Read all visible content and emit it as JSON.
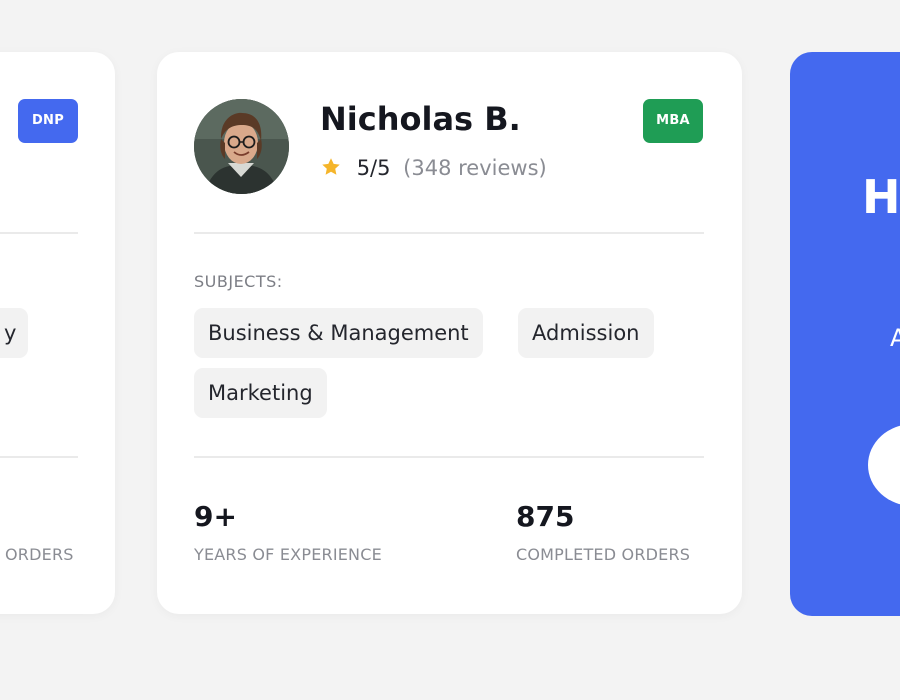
{
  "left_card": {
    "badge": "DNP",
    "tag_fragment": "y",
    "stat_label_fragment": "ORDERS",
    "badge_color": "#4469ef"
  },
  "main_card": {
    "name": "Nicholas B.",
    "rating": "5/5",
    "reviews": "(348 reviews)",
    "badge": "MBA",
    "badge_color": "#1f9d55",
    "subjects_label": "SUBJECTS:",
    "subjects": [
      "Business & Management",
      "Admission",
      "Marketing"
    ],
    "stats": [
      {
        "value": "9+",
        "label": "YEARS OF EXPERIENCE"
      },
      {
        "value": "875",
        "label": "COMPLETED ORDERS"
      }
    ],
    "icons": {
      "rating": "star-icon",
      "avatar": "avatar"
    }
  },
  "right_card": {
    "heading_fragment": "H",
    "subtext_fragment": "A",
    "background_color": "#4469ef"
  }
}
